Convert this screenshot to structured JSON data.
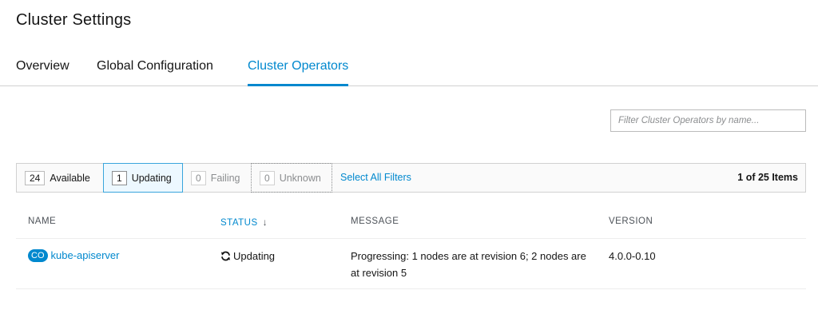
{
  "page": {
    "title": "Cluster Settings"
  },
  "tabs": [
    {
      "label": "Overview"
    },
    {
      "label": "Global Configuration"
    },
    {
      "label": "Cluster Operators"
    }
  ],
  "filter": {
    "placeholder": "Filter Cluster Operators by name..."
  },
  "status_filters": {
    "available": {
      "count": "24",
      "label": "Available"
    },
    "updating": {
      "count": "1",
      "label": "Updating"
    },
    "failing": {
      "count": "0",
      "label": "Failing"
    },
    "unknown": {
      "count": "0",
      "label": "Unknown"
    },
    "select_all_label": "Select All Filters",
    "items_count": "1 of 25 Items"
  },
  "table": {
    "columns": {
      "name": "NAME",
      "status": "STATUS",
      "message": "MESSAGE",
      "version": "VERSION"
    },
    "rows": [
      {
        "badge": "CO",
        "name": "kube-apiserver",
        "status": "Updating",
        "message": "Progressing: 1 nodes are at revision 6; 2 nodes are at revision 5",
        "version": "4.0.0-0.10"
      }
    ]
  },
  "icons": {
    "status_updating": "sync-icon",
    "sort": "sort-down-arrow-icon"
  },
  "colors": {
    "accent": "#0088ce",
    "text": "#151515",
    "muted": "#8b8d8f",
    "border": "#d1d1d1"
  }
}
